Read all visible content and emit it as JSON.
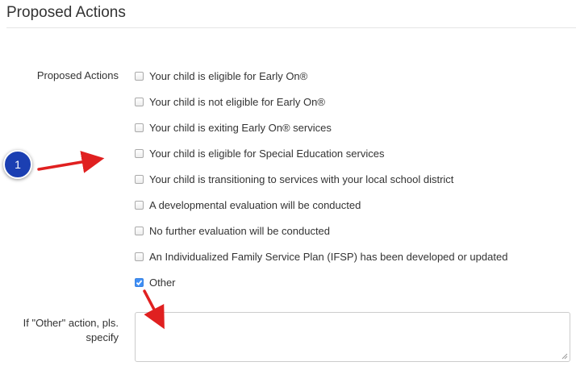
{
  "section": {
    "title": "Proposed Actions"
  },
  "actions": {
    "label": "Proposed Actions",
    "options": [
      {
        "label": "Your child is eligible for Early On®",
        "checked": false
      },
      {
        "label": "Your child is not eligible for Early On®",
        "checked": false
      },
      {
        "label": "Your child is exiting Early On® services",
        "checked": false
      },
      {
        "label": "Your child is eligible for Special Education services",
        "checked": false
      },
      {
        "label": "Your child is transitioning to services with your local school district",
        "checked": false
      },
      {
        "label": "A developmental evaluation will be conducted",
        "checked": false
      },
      {
        "label": "No further evaluation will be conducted",
        "checked": false
      },
      {
        "label": "An Individualized Family Service Plan (IFSP) has been developed or updated",
        "checked": false
      },
      {
        "label": "Other",
        "checked": true
      }
    ]
  },
  "other": {
    "label_line1": "If \"Other\" action, pls.",
    "label_line2": "specify",
    "value": ""
  },
  "annotation": {
    "step_number": "1",
    "arrow_color": "#e02020",
    "badge_color": "#1b3fb2"
  },
  "colors": {
    "checked_fill": "#3f8ff6",
    "text": "#333333",
    "rule": "#e5e5e5"
  }
}
